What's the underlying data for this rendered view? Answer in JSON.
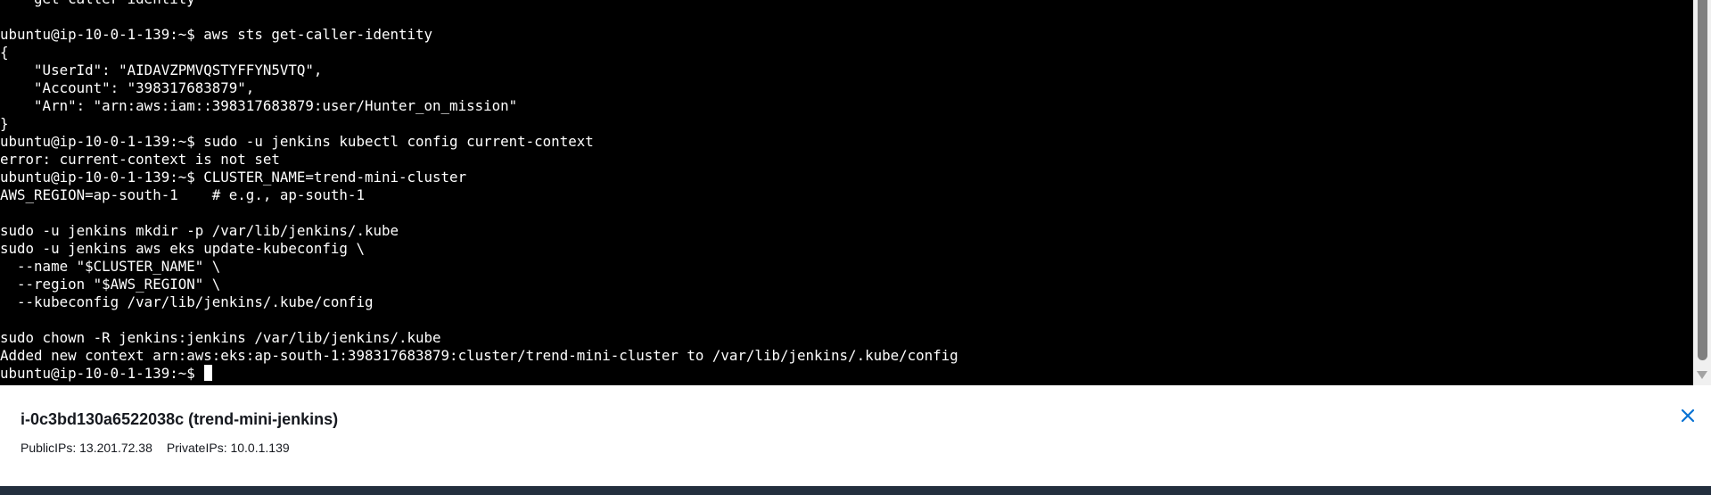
{
  "terminal": {
    "lines": [
      "  * get-caller-identity",
      "",
      "ubuntu@ip-10-0-1-139:~$ aws sts get-caller-identity",
      "{",
      "    \"UserId\": \"AIDAVZPMVQSTYFFYN5VTQ\",",
      "    \"Account\": \"398317683879\",",
      "    \"Arn\": \"arn:aws:iam::398317683879:user/Hunter_on_mission\"",
      "}",
      "ubuntu@ip-10-0-1-139:~$ sudo -u jenkins kubectl config current-context",
      "error: current-context is not set",
      "ubuntu@ip-10-0-1-139:~$ CLUSTER_NAME=trend-mini-cluster",
      "AWS_REGION=ap-south-1    # e.g., ap-south-1",
      "",
      "sudo -u jenkins mkdir -p /var/lib/jenkins/.kube",
      "sudo -u jenkins aws eks update-kubeconfig \\",
      "  --name \"$CLUSTER_NAME\" \\",
      "  --region \"$AWS_REGION\" \\",
      "  --kubeconfig /var/lib/jenkins/.kube/config",
      "",
      "sudo chown -R jenkins:jenkins /var/lib/jenkins/.kube",
      "Added new context arn:aws:eks:ap-south-1:398317683879:cluster/trend-mini-cluster to /var/lib/jenkins/.kube/config"
    ],
    "current_prompt": "ubuntu@ip-10-0-1-139:~$"
  },
  "instance_panel": {
    "title": "i-0c3bd130a6522038c (trend-mini-jenkins)",
    "public_ips_label": "PublicIPs: 13.201.72.38",
    "private_ips_label": "PrivateIPs: 10.0.1.139",
    "close_icon": "close-icon"
  },
  "colors": {
    "terminal_background": "#000000",
    "terminal_text": "#ffffff",
    "panel_background": "#ffffff",
    "close_icon": "#0972d3",
    "bottom_bar": "#232f3e"
  }
}
